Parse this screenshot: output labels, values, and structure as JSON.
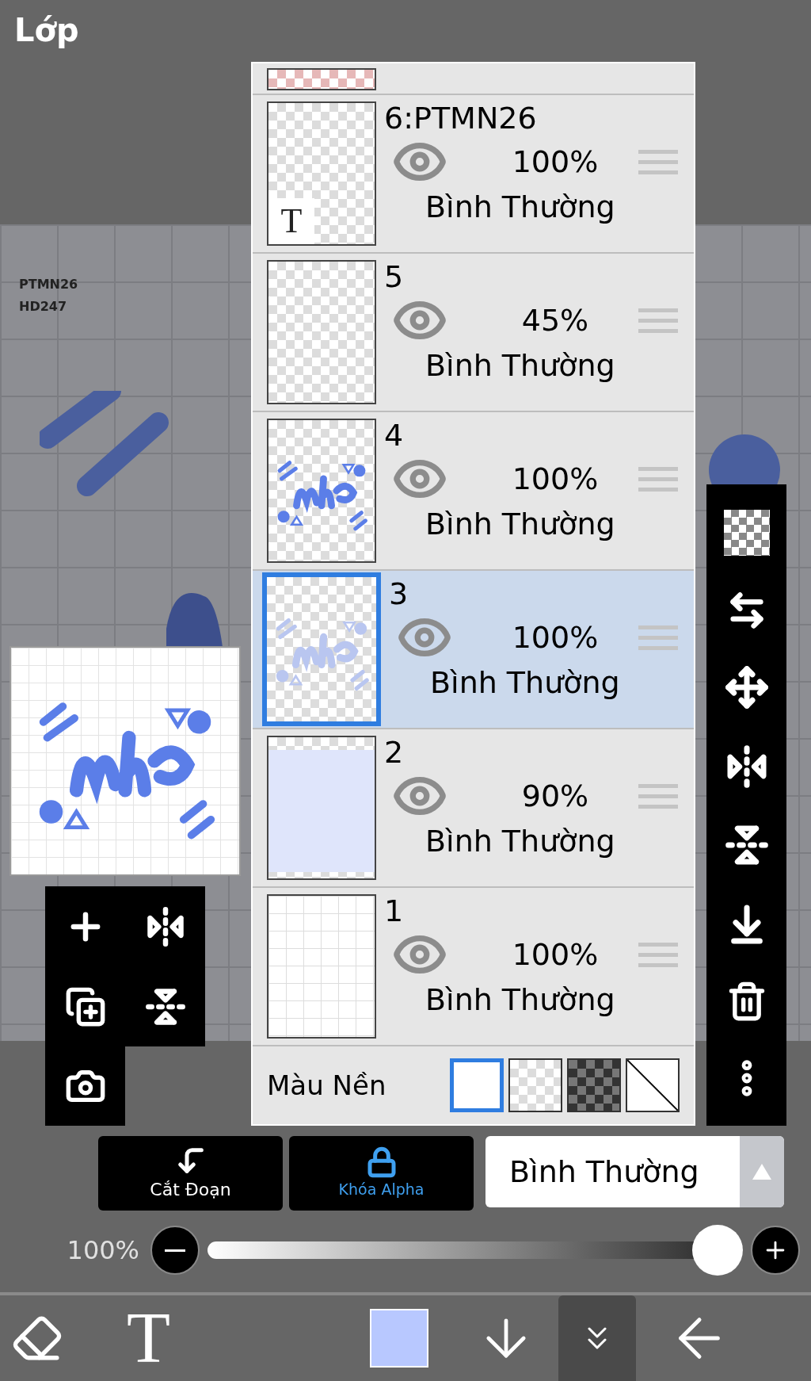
{
  "title": "Lớp",
  "canvas_text": [
    "PTMN26",
    "HD247"
  ],
  "layers": [
    {
      "name": "6:PTMN26",
      "visible": true,
      "opacity": "100%",
      "blend": "Bình Thường",
      "selected": false,
      "kind": "text",
      "thumb_glyph": "T"
    },
    {
      "name": "5",
      "visible": true,
      "opacity": "45%",
      "blend": "Bình Thường",
      "selected": false,
      "kind": "empty"
    },
    {
      "name": "4",
      "visible": true,
      "opacity": "100%",
      "blend": "Bình Thường",
      "selected": false,
      "kind": "art"
    },
    {
      "name": "3",
      "visible": true,
      "opacity": "100%",
      "blend": "Bình Thường",
      "selected": true,
      "kind": "art_faint"
    },
    {
      "name": "2",
      "visible": true,
      "opacity": "90%",
      "blend": "Bình Thường",
      "selected": false,
      "kind": "tint"
    },
    {
      "name": "1",
      "visible": true,
      "opacity": "100%",
      "blend": "Bình Thường",
      "selected": false,
      "kind": "grid"
    }
  ],
  "background_color": {
    "label": "Màu Nền",
    "options": [
      {
        "kind": "white",
        "selected": true
      },
      {
        "kind": "checker_light",
        "selected": false
      },
      {
        "kind": "checker_dark",
        "selected": false
      },
      {
        "kind": "none",
        "selected": false
      }
    ]
  },
  "buttons": [
    {
      "kind": "clip",
      "label": "Cắt Đoạn",
      "on": false
    },
    {
      "kind": "alpha_lock",
      "label": "Khóa Alpha",
      "on": true
    }
  ],
  "blend_mode": "Bình Thường",
  "opacity": {
    "reading": "100%",
    "level": 1
  },
  "toolbar": {
    "text_glyph": "T",
    "color": "#b8c8ff"
  }
}
